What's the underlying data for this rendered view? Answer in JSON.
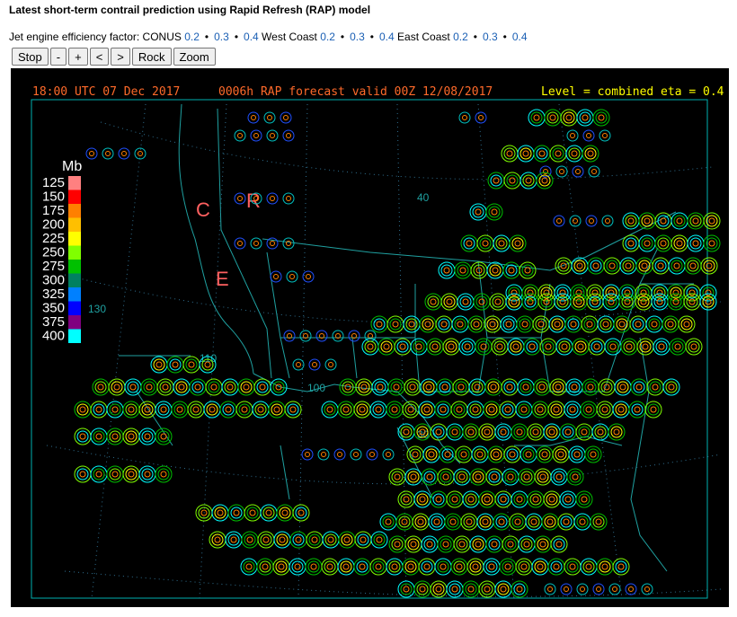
{
  "title": "Latest short-term contrail prediction using Rapid Refresh (RAP) model",
  "factors": {
    "label": "Jet engine efficiency factor:",
    "groups": [
      {
        "name": "CONUS",
        "values": [
          "0.2",
          "0.3",
          "0.4"
        ]
      },
      {
        "name": "West Coast",
        "values": [
          "0.2",
          "0.3",
          "0.4"
        ]
      },
      {
        "name": "East Coast",
        "values": [
          "0.2",
          "0.3",
          "0.4"
        ]
      }
    ]
  },
  "controls": {
    "stop": "Stop",
    "minus": "-",
    "plus": "+",
    "prev": "<",
    "next": ">",
    "rock": "Rock",
    "zoom": "Zoom"
  },
  "map": {
    "header_time": "18:00 UTC 07 Dec 2017",
    "header_forecast": "0006h RAP forecast valid 00Z 12/08/2017",
    "header_level": "Level = combined  eta = 0.4",
    "letters": {
      "c": "C",
      "r": "R",
      "e": "E"
    },
    "lat_labels": {
      "l40": "40",
      "l130": "130",
      "l110": "110",
      "l100": "100",
      "l30": "30"
    },
    "legend": {
      "unit": "Mb",
      "levels": [
        "125",
        "150",
        "175",
        "200",
        "225",
        "250",
        "275",
        "300",
        "325",
        "350",
        "375",
        "400"
      ],
      "colors": [
        "#ff8080",
        "#ff0000",
        "#ff8000",
        "#ffbf00",
        "#ffff00",
        "#80ff00",
        "#00c000",
        "#008060",
        "#0080ff",
        "#0000ff",
        "#800080",
        "#00ffff"
      ]
    }
  }
}
